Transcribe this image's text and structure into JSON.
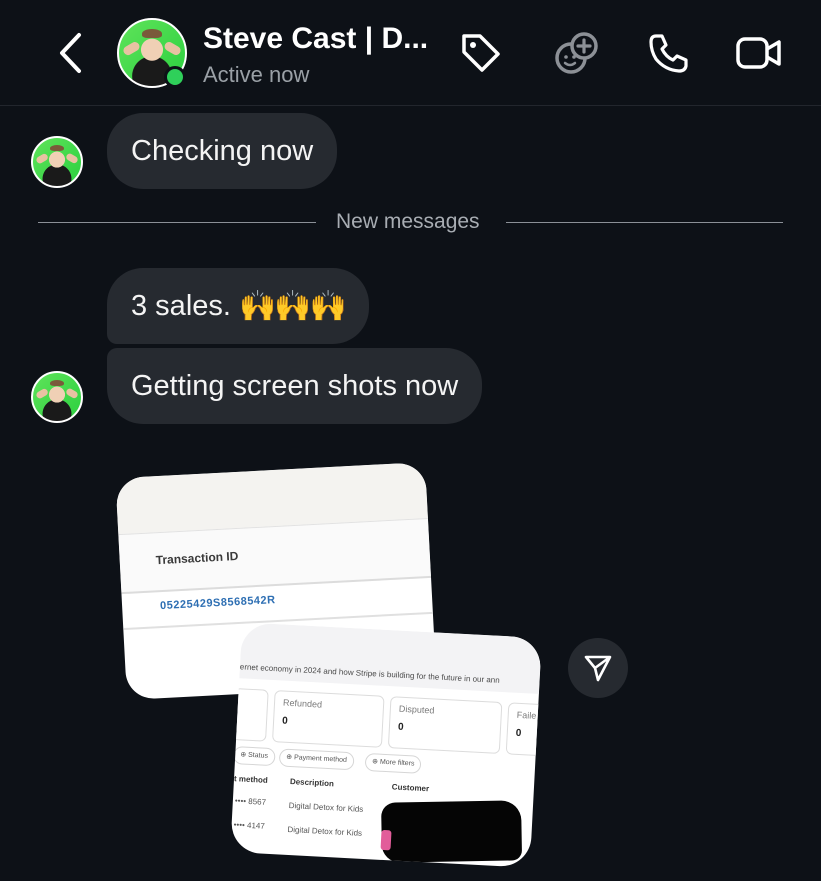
{
  "header": {
    "title": "Steve Cast | D...",
    "status": "Active now",
    "icons": [
      "back-chevron-icon",
      "tag-icon",
      "sticker-add-icon",
      "phone-icon",
      "video-camera-icon"
    ]
  },
  "messages": [
    {
      "text": "Checking now"
    },
    {
      "text": "3 sales.",
      "emoji": "🙌🙌🙌"
    },
    {
      "text": "Getting screen shots now"
    }
  ],
  "divider": {
    "label": "New messages"
  },
  "screenshot1": {
    "column_header": "Transaction ID",
    "transaction_id": "05225429S8568542R"
  },
  "screenshot2": {
    "banner": "ernet economy in 2024 and how Stripe is building for the future in our ann",
    "stats": [
      {
        "label": "Refunded",
        "value": "0"
      },
      {
        "label": "Disputed",
        "value": "0"
      },
      {
        "label": "Faile",
        "value": "0"
      }
    ],
    "filters": [
      "Status",
      "Payment method",
      "More filters"
    ],
    "columns": [
      "t method",
      "Description",
      "Customer"
    ],
    "rows": [
      {
        "method": "•••• 8567",
        "description": "Digital Detox for Kids"
      },
      {
        "method": "•••• 4147",
        "description": "Digital Detox for Kids"
      }
    ]
  }
}
